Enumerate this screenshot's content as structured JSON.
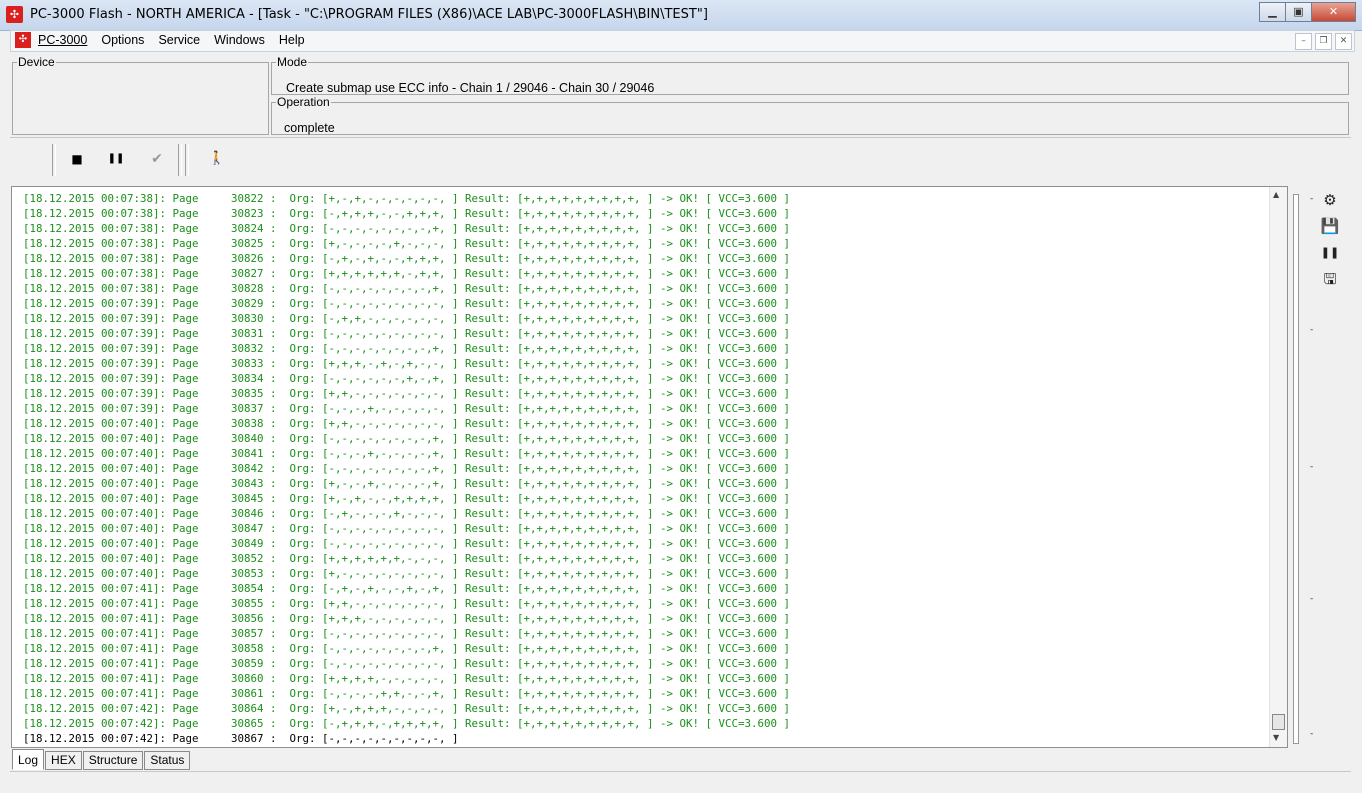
{
  "window": {
    "title": "PC-3000 Flash  - NORTH AMERICA - [Task - \"C:\\PROGRAM FILES (X86)\\ACE LAB\\PC-3000FLASH\\BIN\\TEST\"]",
    "app_icon_glyph": "✣",
    "minimize_glyph": "▁",
    "maximize_glyph": "▣",
    "close_glyph": "✕"
  },
  "menubar": {
    "items": [
      "PC-3000",
      "Options",
      "Service",
      "Windows",
      "Help"
    ],
    "mdi_minimize": "–",
    "mdi_restore": "❐",
    "mdi_close": "✕"
  },
  "device": {
    "legend": "Device"
  },
  "mode": {
    "legend": "Mode",
    "value": "Create submap use ECC info - Chain 1 / 29046 - Chain 30 / 29046"
  },
  "operation": {
    "legend": "Operation",
    "value": "complete"
  },
  "toolbar": {
    "stop_glyph": "■",
    "pause_glyph": "❚❚",
    "check_glyph": "✔",
    "exit_glyph": "🚶"
  },
  "log": {
    "lines": [
      "[18.12.2015 00:07:38]: Page     30822 :  Org: [+,-,+,-,-,-,-,-,-, ] Result: [+,+,+,+,+,+,+,+,+, ] -> OK! [ VCC=3.600 ]",
      "[18.12.2015 00:07:38]: Page     30823 :  Org: [-,+,+,+,-,-,+,+,+, ] Result: [+,+,+,+,+,+,+,+,+, ] -> OK! [ VCC=3.600 ]",
      "[18.12.2015 00:07:38]: Page     30824 :  Org: [-,-,-,-,-,-,-,-,+, ] Result: [+,+,+,+,+,+,+,+,+, ] -> OK! [ VCC=3.600 ]",
      "[18.12.2015 00:07:38]: Page     30825 :  Org: [+,-,-,-,-,+,-,-,-, ] Result: [+,+,+,+,+,+,+,+,+, ] -> OK! [ VCC=3.600 ]",
      "[18.12.2015 00:07:38]: Page     30826 :  Org: [-,+,-,+,-,-,+,+,+, ] Result: [+,+,+,+,+,+,+,+,+, ] -> OK! [ VCC=3.600 ]",
      "[18.12.2015 00:07:38]: Page     30827 :  Org: [+,+,+,+,+,+,-,+,+, ] Result: [+,+,+,+,+,+,+,+,+, ] -> OK! [ VCC=3.600 ]",
      "[18.12.2015 00:07:38]: Page     30828 :  Org: [-,-,-,-,-,-,-,-,+, ] Result: [+,+,+,+,+,+,+,+,+, ] -> OK! [ VCC=3.600 ]",
      "[18.12.2015 00:07:39]: Page     30829 :  Org: [-,-,-,-,-,-,-,-,-, ] Result: [+,+,+,+,+,+,+,+,+, ] -> OK! [ VCC=3.600 ]",
      "[18.12.2015 00:07:39]: Page     30830 :  Org: [-,+,+,-,-,-,-,-,-, ] Result: [+,+,+,+,+,+,+,+,+, ] -> OK! [ VCC=3.600 ]",
      "[18.12.2015 00:07:39]: Page     30831 :  Org: [-,-,-,-,-,-,-,-,-, ] Result: [+,+,+,+,+,+,+,+,+, ] -> OK! [ VCC=3.600 ]",
      "[18.12.2015 00:07:39]: Page     30832 :  Org: [-,-,-,-,-,-,-,-,+, ] Result: [+,+,+,+,+,+,+,+,+, ] -> OK! [ VCC=3.600 ]",
      "[18.12.2015 00:07:39]: Page     30833 :  Org: [+,+,+,-,+,-,+,-,-, ] Result: [+,+,+,+,+,+,+,+,+, ] -> OK! [ VCC=3.600 ]",
      "[18.12.2015 00:07:39]: Page     30834 :  Org: [-,-,-,-,-,-,+,-,+, ] Result: [+,+,+,+,+,+,+,+,+, ] -> OK! [ VCC=3.600 ]",
      "[18.12.2015 00:07:39]: Page     30835 :  Org: [+,+,-,-,-,-,-,-,-, ] Result: [+,+,+,+,+,+,+,+,+, ] -> OK! [ VCC=3.600 ]",
      "[18.12.2015 00:07:39]: Page     30837 :  Org: [-,-,-,+,-,-,-,-,-, ] Result: [+,+,+,+,+,+,+,+,+, ] -> OK! [ VCC=3.600 ]",
      "[18.12.2015 00:07:40]: Page     30838 :  Org: [+,+,-,-,-,-,-,-,-, ] Result: [+,+,+,+,+,+,+,+,+, ] -> OK! [ VCC=3.600 ]",
      "[18.12.2015 00:07:40]: Page     30840 :  Org: [-,-,-,-,-,-,-,-,+, ] Result: [+,+,+,+,+,+,+,+,+, ] -> OK! [ VCC=3.600 ]",
      "[18.12.2015 00:07:40]: Page     30841 :  Org: [-,-,-,+,-,-,-,-,+, ] Result: [+,+,+,+,+,+,+,+,+, ] -> OK! [ VCC=3.600 ]",
      "[18.12.2015 00:07:40]: Page     30842 :  Org: [-,-,-,-,-,-,-,-,+, ] Result: [+,+,+,+,+,+,+,+,+, ] -> OK! [ VCC=3.600 ]",
      "[18.12.2015 00:07:40]: Page     30843 :  Org: [+,-,-,+,-,-,-,-,+, ] Result: [+,+,+,+,+,+,+,+,+, ] -> OK! [ VCC=3.600 ]",
      "[18.12.2015 00:07:40]: Page     30845 :  Org: [+,-,+,-,-,+,+,+,+, ] Result: [+,+,+,+,+,+,+,+,+, ] -> OK! [ VCC=3.600 ]",
      "[18.12.2015 00:07:40]: Page     30846 :  Org: [-,+,-,-,-,+,-,-,-, ] Result: [+,+,+,+,+,+,+,+,+, ] -> OK! [ VCC=3.600 ]",
      "[18.12.2015 00:07:40]: Page     30847 :  Org: [-,-,-,-,-,-,-,-,-, ] Result: [+,+,+,+,+,+,+,+,+, ] -> OK! [ VCC=3.600 ]",
      "[18.12.2015 00:07:40]: Page     30849 :  Org: [-,-,-,-,-,-,-,-,-, ] Result: [+,+,+,+,+,+,+,+,+, ] -> OK! [ VCC=3.600 ]",
      "[18.12.2015 00:07:40]: Page     30852 :  Org: [+,+,+,+,+,+,-,-,-, ] Result: [+,+,+,+,+,+,+,+,+, ] -> OK! [ VCC=3.600 ]",
      "[18.12.2015 00:07:40]: Page     30853 :  Org: [+,-,-,-,-,-,-,-,-, ] Result: [+,+,+,+,+,+,+,+,+, ] -> OK! [ VCC=3.600 ]",
      "[18.12.2015 00:07:41]: Page     30854 :  Org: [-,+,-,+,-,-,+,-,+, ] Result: [+,+,+,+,+,+,+,+,+, ] -> OK! [ VCC=3.600 ]",
      "[18.12.2015 00:07:41]: Page     30855 :  Org: [+,+,-,-,-,-,-,-,-, ] Result: [+,+,+,+,+,+,+,+,+, ] -> OK! [ VCC=3.600 ]",
      "[18.12.2015 00:07:41]: Page     30856 :  Org: [+,+,+,-,-,-,-,-,-, ] Result: [+,+,+,+,+,+,+,+,+, ] -> OK! [ VCC=3.600 ]",
      "[18.12.2015 00:07:41]: Page     30857 :  Org: [-,-,-,-,-,-,-,-,-, ] Result: [+,+,+,+,+,+,+,+,+, ] -> OK! [ VCC=3.600 ]",
      "[18.12.2015 00:07:41]: Page     30858 :  Org: [-,-,-,-,-,-,-,-,+, ] Result: [+,+,+,+,+,+,+,+,+, ] -> OK! [ VCC=3.600 ]",
      "[18.12.2015 00:07:41]: Page     30859 :  Org: [-,-,-,-,-,-,-,-,-, ] Result: [+,+,+,+,+,+,+,+,+, ] -> OK! [ VCC=3.600 ]",
      "[18.12.2015 00:07:41]: Page     30860 :  Org: [+,+,+,+,-,-,-,-,-, ] Result: [+,+,+,+,+,+,+,+,+, ] -> OK! [ VCC=3.600 ]",
      "[18.12.2015 00:07:41]: Page     30861 :  Org: [-,-,-,-,+,+,-,-,+, ] Result: [+,+,+,+,+,+,+,+,+, ] -> OK! [ VCC=3.600 ]",
      "[18.12.2015 00:07:42]: Page     30864 :  Org: [+,-,+,+,+,-,-,-,-, ] Result: [+,+,+,+,+,+,+,+,+, ] -> OK! [ VCC=3.600 ]",
      "[18.12.2015 00:07:42]: Page     30865 :  Org: [-,+,+,+,-,+,+,+,+, ] Result: [+,+,+,+,+,+,+,+,+, ] -> OK! [ VCC=3.600 ]",
      "[18.12.2015 00:07:42]: Page     30867 :  Org: [-,-,-,-,-,-,-,-,-, ]"
    ],
    "scroll_up": "▲",
    "scroll_down": "▼"
  },
  "right_panel": {
    "icons": [
      {
        "name": "settings-page-icon",
        "glyph": "⚙"
      },
      {
        "name": "save-icon",
        "glyph": "💾"
      },
      {
        "name": "pause-icon",
        "glyph": "❚❚"
      },
      {
        "name": "save-as-icon",
        "glyph": "🖫"
      }
    ]
  },
  "tabs": [
    "Log",
    "HEX",
    "Structure",
    "Status"
  ],
  "active_tab": "Log",
  "colors": {
    "log_text": "#1a8f1a",
    "log_last": "#000000",
    "title_gradient": "#c5d6ec"
  }
}
